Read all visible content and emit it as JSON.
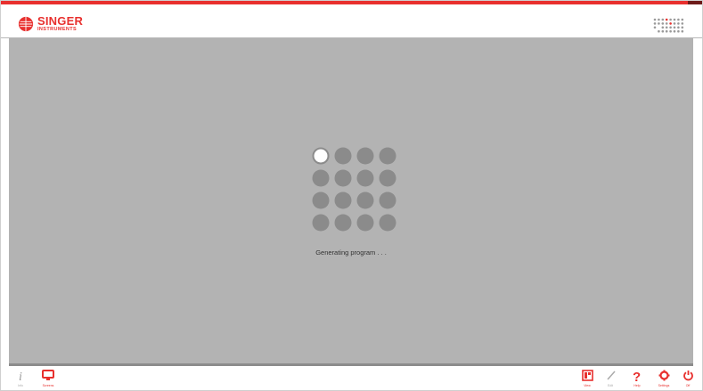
{
  "brand": {
    "name": "SINGER",
    "subtitle": "INSTRUMENTS",
    "accent_color": "#e8302e",
    "dark_accent_color": "#6d1a19"
  },
  "status": {
    "message": "Generating program . . ."
  },
  "spinner": {
    "rows": 4,
    "cols": 4,
    "active_index": 0,
    "dot_color": "#8b8b8b",
    "active_ring_color": "#8b8b8b"
  },
  "footer": {
    "left": [
      {
        "name": "info-button",
        "label": "Info",
        "icon": "info-icon",
        "active": false
      },
      {
        "name": "screens-button",
        "label": "Screens",
        "icon": "monitor-icon",
        "active": true
      }
    ],
    "right": [
      {
        "name": "view-button",
        "label": "View",
        "icon": "panel-icon",
        "active": true
      },
      {
        "name": "edit-button",
        "label": "Edit",
        "icon": "pencil-icon",
        "active": false
      },
      {
        "name": "help-button",
        "label": "Help",
        "icon": "question-icon",
        "active": true
      },
      {
        "name": "settings-button",
        "label": "Settings",
        "icon": "gear-icon",
        "active": true
      },
      {
        "name": "off-button",
        "label": "Off",
        "icon": "power-icon",
        "active": true
      }
    ]
  }
}
